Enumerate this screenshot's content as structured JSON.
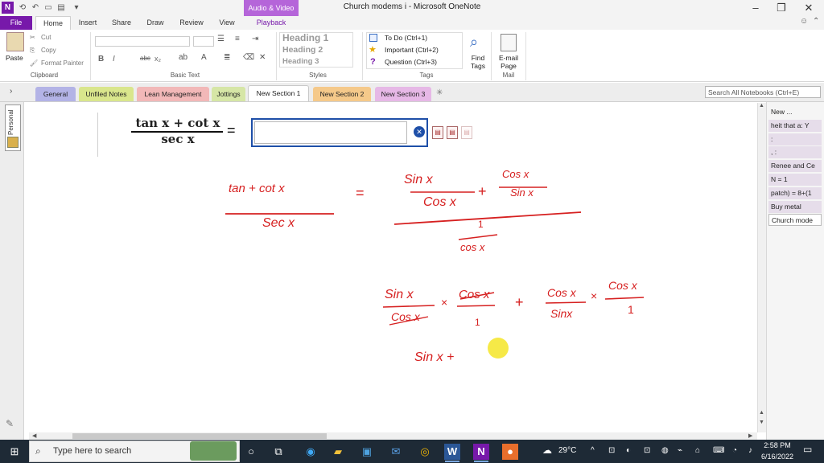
{
  "window": {
    "title": "Church modems i  -  Microsoft OneNote",
    "context_tab": "Audio & Video",
    "context_subtab": "Playback",
    "app_icon": "N"
  },
  "ribbon_tabs": [
    "File",
    "Home",
    "Insert",
    "Share",
    "Draw",
    "Review",
    "View",
    "Playback"
  ],
  "clipboard": {
    "paste": "Paste",
    "cut": "Cut",
    "copy": "Copy",
    "format_painter": "Format Painter",
    "label": "Clipboard"
  },
  "basic_text": {
    "label": "Basic Text",
    "bold": "B",
    "italic": "I",
    "strike": "abc",
    "sub": "x₂"
  },
  "styles": {
    "label": "Styles",
    "items": [
      "Heading 1",
      "Heading 2",
      "Heading 3"
    ]
  },
  "tags": {
    "label": "Tags",
    "items": [
      "To Do (Ctrl+1)",
      "Important (Ctrl+2)",
      "Question (Ctrl+3)"
    ],
    "find_tags": "Find Tags",
    "find_tags_l1": "Find",
    "find_tags_l2": "Tags"
  },
  "mail": {
    "label": "Mail",
    "email_l1": "E-mail",
    "email_l2": "Page"
  },
  "sections": [
    {
      "name": "General",
      "color": "#b3b3e6"
    },
    {
      "name": "Unfiled Notes",
      "color": "#d9e68c"
    },
    {
      "name": "Lean Management",
      "color": "#f2b8b8"
    },
    {
      "name": "Jottings",
      "color": "#d6e6a6"
    },
    {
      "name": "New Section 1",
      "color": "#ffffff"
    },
    {
      "name": "New Section 2",
      "color": "#f5c98a"
    },
    {
      "name": "New Section 3",
      "color": "#e6b8e6"
    }
  ],
  "search": {
    "placeholder": "Search All Notebooks (Ctrl+E)"
  },
  "notebook": {
    "name": "Personal"
  },
  "pages": [
    "New ...",
    "heit that a: Y",
    ":",
    ", :",
    "Renee and Ce",
    "N = 1",
    "patch) = 8+(1",
    "Buy metal",
    "Church mode"
  ],
  "equation": {
    "numerator": "tan x + cot x",
    "denominator": "sec x",
    "equals": "="
  },
  "handwriting": {
    "line1_lhs_num": "tan + cot x",
    "line1_lhs_den": "Sec x",
    "line1_eq": "=",
    "line1_rhs_a_num": "Sin x",
    "line1_rhs_a_den": "Cos x",
    "plus": "+",
    "line1_rhs_b_num": "Cos x",
    "line1_rhs_b_den": "Sin x",
    "line1_rhs_den_num": "1",
    "line1_rhs_den_den": "cos x",
    "line2_a_num": "Sin x",
    "line2_a_den": "Cos x",
    "times": "×",
    "line2_b_num": "Cos x",
    "line2_b_den": "1",
    "line2_c_num": "Cos x",
    "line2_c_den": "Sinx",
    "line2_d_num": "Cos x",
    "line2_d_den": "1",
    "line3": "Sin x +"
  },
  "taskbar": {
    "search_placeholder": "Type here to search",
    "weather": "29°C",
    "time": "2:58 PM",
    "date": "6/16/2022"
  }
}
